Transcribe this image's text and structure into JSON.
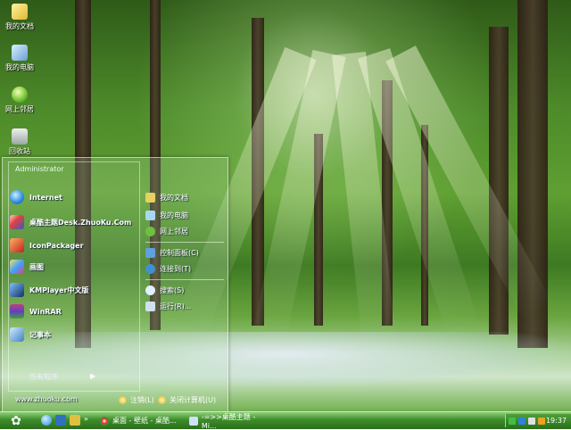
{
  "desktop": {
    "icons": [
      {
        "label": "我的文档",
        "icon": "folder-icon"
      },
      {
        "label": "我的电脑",
        "icon": "computer-icon"
      },
      {
        "label": "网上邻居",
        "icon": "network-icon"
      },
      {
        "label": "回收站",
        "icon": "recycle-bin-icon"
      }
    ]
  },
  "start_menu": {
    "user": "Administrator",
    "programs": [
      {
        "label": "Internet",
        "icon": "internet-explorer-icon"
      },
      {
        "label": "桌酷主题Desk.ZhuoKu.Com",
        "icon": "theme-icon"
      },
      {
        "label": "IconPackager",
        "icon": "iconpackager-icon"
      },
      {
        "label": "画图",
        "icon": "paint-icon"
      },
      {
        "label": "KMPlayer中文版",
        "icon": "kmplayer-icon"
      },
      {
        "label": "WinRAR",
        "icon": "winrar-icon"
      },
      {
        "label": "记事本",
        "icon": "notepad-icon"
      }
    ],
    "all_programs": "所有程序",
    "places": [
      {
        "label": "我的文档",
        "icon": "folder-icon"
      },
      {
        "label": "我的电脑",
        "icon": "computer-icon"
      },
      {
        "label": "网上邻居",
        "icon": "network-icon"
      }
    ],
    "system": [
      {
        "label": "控制面板(C)",
        "icon": "control-panel-icon"
      },
      {
        "label": "连接到(T)",
        "icon": "connect-icon"
      }
    ],
    "tools": [
      {
        "label": "搜索(S)",
        "icon": "search-icon"
      },
      {
        "label": "运行(R)...",
        "icon": "run-icon"
      }
    ],
    "website": "www.zhuoku.com",
    "logoff": "注销(L)",
    "shutdown": "关闭计算机(U)"
  },
  "taskbar": {
    "tasks": [
      {
        "label": "桌面 - 壁纸 - 桌酷...",
        "icon": "browser-icon"
      },
      {
        "label": "-=>>桌酷主题 - Mi...",
        "icon": "document-icon"
      }
    ],
    "clock": "19:37"
  }
}
